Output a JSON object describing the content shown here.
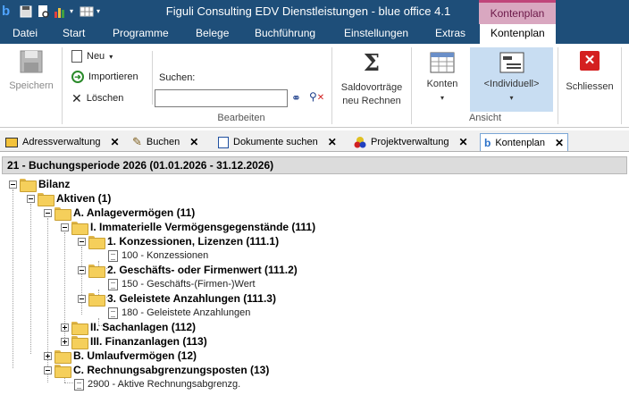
{
  "window": {
    "title": "Figuli Consulting EDV Dienstleistungen - blue office 4.1",
    "context_tab": "Kontenplan"
  },
  "menu": [
    "Datei",
    "Start",
    "Programme",
    "Belege",
    "Buchführung",
    "Einstellungen",
    "Extras",
    "Kontenplan"
  ],
  "ribbon": {
    "save": "Speichern",
    "neu": "Neu",
    "importieren": "Importieren",
    "loeschen": "Löschen",
    "search_label": "Suchen:",
    "search_value": "",
    "group_bearbeiten": "Bearbeiten",
    "saldo_line1": "Saldovorträge",
    "saldo_line2": "neu Rechnen",
    "konten": "Konten",
    "individuell": "<Individuell>",
    "group_ansicht": "Ansicht",
    "schliessen": "Schliessen"
  },
  "doc_tabs": [
    "Adressverwaltung",
    "Buchen",
    "Dokumente suchen",
    "Projektverwaltung",
    "Kontenplan"
  ],
  "period": "21 - Buchungsperiode 2026 (01.01.2026 - 31.12.2026)",
  "tree": [
    "Bilanz",
    "Aktiven (1)",
    "A. Anlagevermögen (11)",
    "I. Immaterielle Vermögensgegenstände (111)",
    "1. Konzessionen, Lizenzen (111.1)",
    "100 - Konzessionen",
    "2. Geschäfts- oder Firmenwert (111.2)",
    "150 - Geschäfts-(Firmen-)Wert",
    "3. Geleistete Anzahlungen (111.3)",
    "180 - Geleistete Anzahlungen",
    "II. Sachanlagen (112)",
    "III. Finanzanlagen (113)",
    "B. Umlaufvermögen (12)",
    "C. Rechnungsabgrenzungsposten (13)",
    "2900 - Aktive Rechnungsabgrenzg."
  ],
  "colors": {
    "titlebar": "#1e4e79",
    "context_band": "#d9a7c0",
    "folder": "#f5cf5b"
  }
}
